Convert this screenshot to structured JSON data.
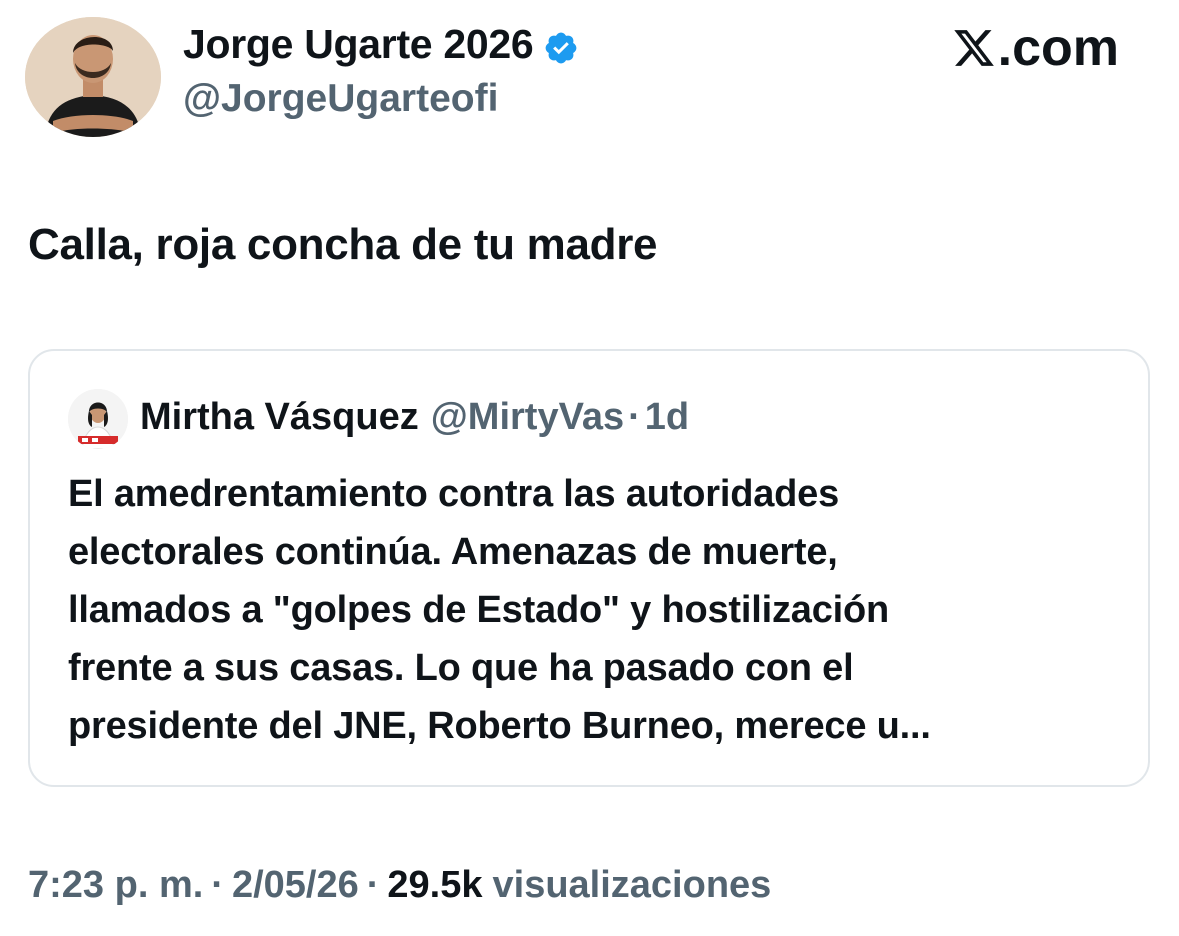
{
  "author": {
    "name": "Jorge Ugarte 2026",
    "handle": "@JorgeUgarteofi",
    "verified": true,
    "verified_color": "#1d9bf0",
    "avatar_icon": "person-arms-crossed-avatar"
  },
  "brand": {
    "logo_text": ".com",
    "logo_icon": "x-logo-icon"
  },
  "tweet": {
    "text": "Calla, roja concha de tu madre"
  },
  "quote": {
    "name": "Mirtha Vásquez",
    "handle": "@MirtyVas",
    "separator": "·",
    "time": "1d",
    "avatar_icon": "person-portrait-avatar",
    "lines": [
      "El amedrentamiento contra las autoridades",
      "electorales continúa. Amenazas de muerte,",
      "llamados a \"golpes de Estado\" y hostilización",
      "frente a sus casas. Lo que ha pasado con el",
      "presidente del JNE, Roberto Burneo, merece u..."
    ]
  },
  "meta": {
    "time": "7:23 p. m.",
    "separator": "·",
    "date": "2/05/26",
    "views_count": "29.5k",
    "views_label": "visualizaciones"
  },
  "colors": {
    "text_primary": "#0f1419",
    "text_secondary": "#536471",
    "border": "#e1e6ea",
    "accent": "#1d9bf0"
  }
}
